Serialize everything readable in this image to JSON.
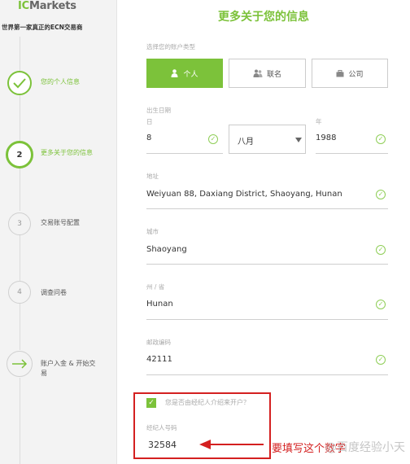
{
  "sidebar": {
    "brand_mark": "IC",
    "brand_name": "Markets",
    "tagline": "世界第一家真正的ECN交易商",
    "steps": [
      {
        "number": "",
        "label": "您的个人信息",
        "status": "done"
      },
      {
        "number": "2",
        "label": "更多关于您的信息",
        "status": "active"
      },
      {
        "number": "3",
        "label": "交易账号配置",
        "status": "pending"
      },
      {
        "number": "4",
        "label": "调查问卷",
        "status": "pending"
      },
      {
        "number": "",
        "label_line1": "账户入金 & 开始交",
        "label_line2": "易",
        "status": "pending"
      }
    ]
  },
  "main": {
    "title": "更多关于您的信息",
    "account_type": {
      "label": "选择您的账户类型",
      "options": [
        "个人",
        "联名",
        "公司"
      ],
      "selected": "个人"
    },
    "dob": {
      "label": "出生日期",
      "day_label": "日",
      "day_value": "8",
      "month_value": "八月",
      "year_label": "年",
      "year_value": "1988"
    },
    "address": {
      "label": "地址",
      "value": "Weiyuan 88, Daxiang District, Shaoyang, Hunan"
    },
    "city": {
      "label": "城市",
      "value": "Shaoyang"
    },
    "province": {
      "label": "州 / 省",
      "value": "Hunan"
    },
    "postcode": {
      "label": "邮政编码",
      "value": "42111"
    },
    "referral": {
      "checkbox_label": "您是否由经纪人介绍来开户？",
      "checked": true
    },
    "broker_id": {
      "label": "经纪人号码",
      "value": "32584"
    }
  },
  "annotation": {
    "text": "要填写这个数字",
    "color": "#d42020"
  },
  "watermark": {
    "text": "@百度经验小天"
  },
  "colors": {
    "accent": "#7cc23a",
    "annotation": "#d42020"
  }
}
